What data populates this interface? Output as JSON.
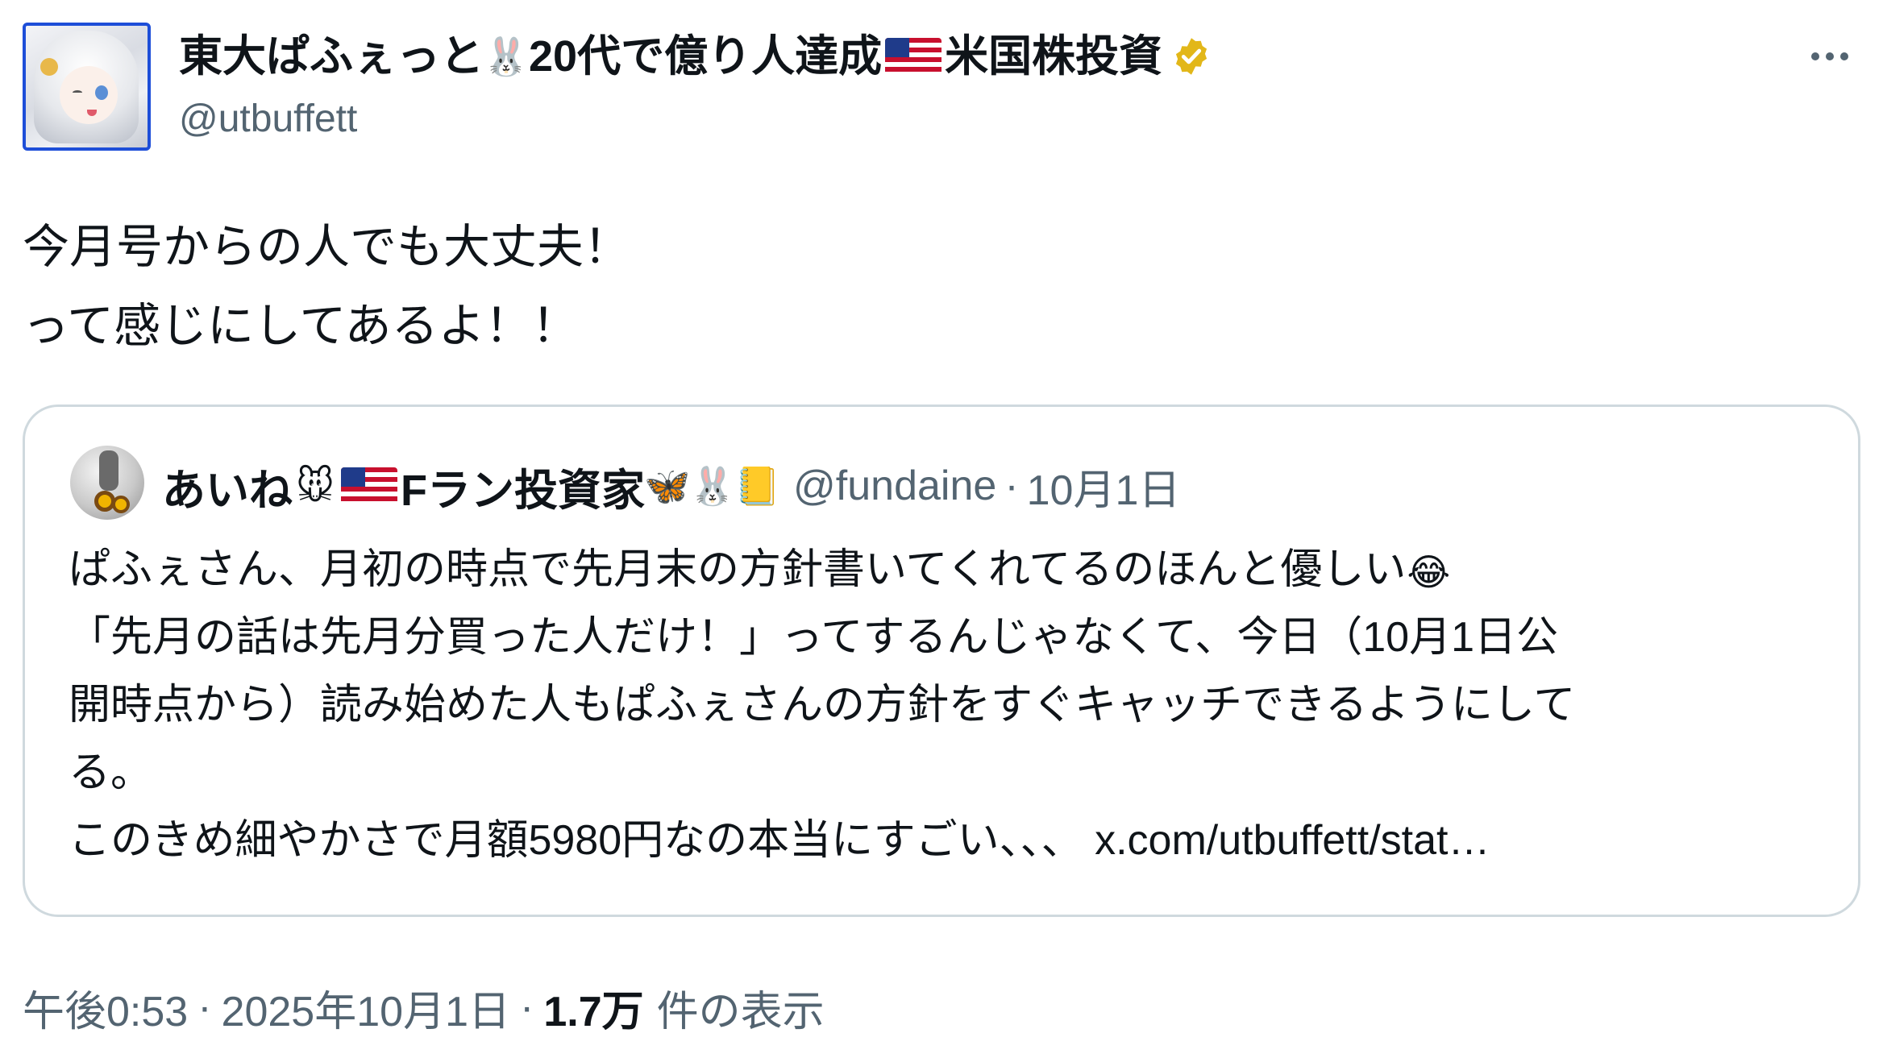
{
  "author": {
    "display_name_parts": [
      "東大ぱふぇっと",
      "20代で億り人達成",
      "米国株投資"
    ],
    "handle": "@utbuffett",
    "verified": true,
    "icons": [
      "rabbit-emoji",
      "us-flag-emoji",
      "gold-verified-badge"
    ]
  },
  "tweet": {
    "lines": [
      "今月号からの人でも大丈夫！",
      "って感じにしてあるよ！！"
    ]
  },
  "quote": {
    "display_name_parts": [
      "あいね",
      "Fラン投資家"
    ],
    "icons": [
      "mouse-emoji",
      "us-flag-emoji",
      "butterfly-emoji",
      "rabbit-emoji",
      "notebook-emoji"
    ],
    "handle": "@fundaine",
    "separator": "·",
    "date": "10月1日",
    "lines": [
      "ぱふぇさん、月初の時点で先月末の方針書いてくれてるのほんと優しい",
      "「先月の話は先月分買った人だけ！」ってするんじゃなくて、今日（10月1日公",
      "開時点から）読み始めた人もぱふぇさんの方針をすぐキャッチできるようにして",
      "る。",
      "このきめ細やかさで月額5980円なの本当にすごい、、、 "
    ],
    "link": "x.com/utbuffett/stat…"
  },
  "meta": {
    "time": "午後0:53",
    "separator": "·",
    "date": "2025年10月1日",
    "views_count": "1.7万",
    "views_label": "件の表示"
  },
  "colors": {
    "text": "#0f1419",
    "secondary": "#536471",
    "border": "#cfd9de",
    "verified_gold": "#e2b719"
  }
}
